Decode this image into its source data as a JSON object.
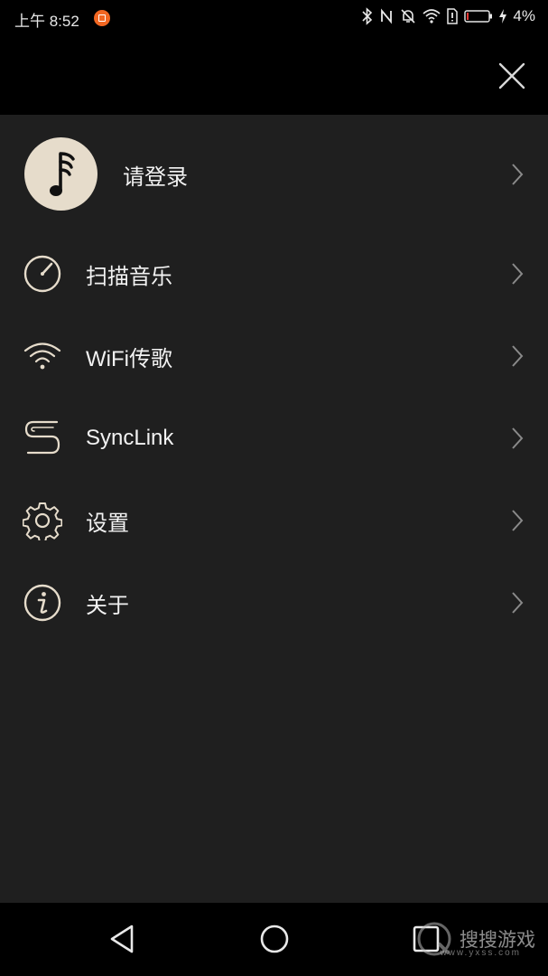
{
  "status_bar": {
    "time": "上午 8:52",
    "battery": "4%"
  },
  "menu": {
    "login": "请登录",
    "items": [
      {
        "label": "扫描音乐",
        "icon": "scan-gauge-icon"
      },
      {
        "label": "WiFi传歌",
        "icon": "wifi-icon"
      },
      {
        "label": "SyncLink",
        "icon": "synclink-icon"
      },
      {
        "label": "设置",
        "icon": "gear-icon"
      },
      {
        "label": "关于",
        "icon": "info-icon"
      }
    ]
  },
  "watermark": {
    "text": "搜搜游戏",
    "sub": "www.yxss.com"
  },
  "colors": {
    "accent": "#e6dccb",
    "panel": "#1f1f1f",
    "chevron": "#8a8a8a"
  }
}
